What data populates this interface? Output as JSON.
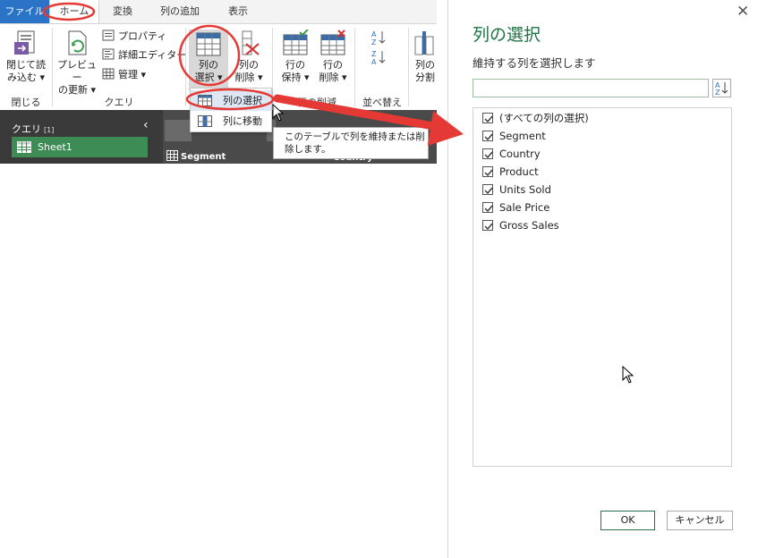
{
  "ribbon": {
    "tabs": [
      "ファイル",
      "ホーム",
      "変換",
      "列の追加",
      "表示"
    ],
    "close": {
      "line1": "閉じて読",
      "line2": "み込む",
      "group": "閉じる"
    },
    "preview": {
      "line1": "プレビュー",
      "line2": "の更新"
    },
    "properties": "プロパティ",
    "advanced_editor": "詳細エディター",
    "manage": "管理",
    "query_group": "クエリ",
    "choose_columns": {
      "line1": "列の",
      "line2": "選択"
    },
    "remove_columns": {
      "line1": "列の",
      "line2": "削除"
    },
    "keep_rows": {
      "line1": "行の",
      "line2": "保持"
    },
    "remove_rows": {
      "line1": "行の",
      "line2": "削除"
    },
    "reduce_rows_group": "行の削減",
    "sort_group": "並べ替え",
    "split_column": {
      "line1": "列の",
      "line2": "分割"
    }
  },
  "dropdown": {
    "items": [
      "列の選択",
      "列に移動"
    ]
  },
  "tooltip": {
    "line1": "このテーブルで列を維持または削",
    "line2": "除します。"
  },
  "queries": {
    "title": "クエリ",
    "count": "[1]",
    "items": [
      "Sheet1"
    ]
  },
  "grid": {
    "col1": "Segment",
    "col2": "Country"
  },
  "dialog": {
    "title": "列の選択",
    "subtitle": "維持する列を選択します",
    "search_placeholder": "",
    "items": [
      {
        "label": "(すべての列の選択)",
        "checked": true
      },
      {
        "label": "Segment",
        "checked": true
      },
      {
        "label": "Country",
        "checked": true
      },
      {
        "label": "Product",
        "checked": true
      },
      {
        "label": "Units Sold",
        "checked": true
      },
      {
        "label": "Sale Price",
        "checked": true
      },
      {
        "label": "Gross Sales",
        "checked": true
      }
    ],
    "ok": "OK",
    "cancel": "キャンセル"
  },
  "colors": {
    "accent_green": "#217346",
    "file_tab": "#2b73c6",
    "annotation_red": "#e53935",
    "query_selected": "#3e8c55"
  }
}
